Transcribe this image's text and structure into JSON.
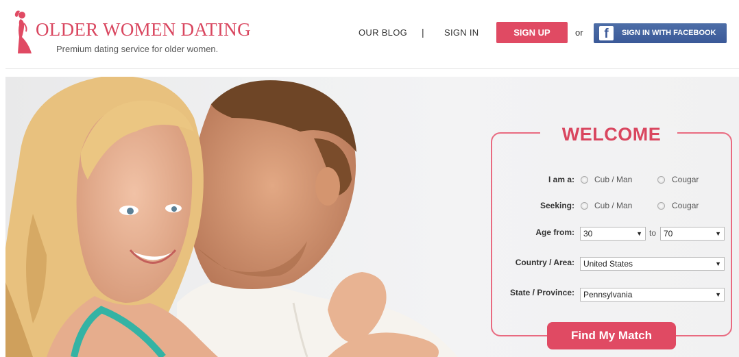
{
  "header": {
    "logo_title": "OLDER WOMEN DATING",
    "tagline": "Premium dating service for older women.",
    "nav": {
      "blog": "OUR BLOG",
      "separator": "|",
      "signin": "SIGN IN"
    },
    "signup": "SIGN UP",
    "or": "or",
    "facebook": {
      "icon_letter": "f",
      "label": "SIGN IN WITH FACEBOOK"
    }
  },
  "form": {
    "title": "WELCOME",
    "i_am_label": "I am a:",
    "i_am_options": [
      "Cub / Man",
      "Cougar"
    ],
    "seeking_label": "Seeking:",
    "seeking_options": [
      "Cub / Man",
      "Cougar"
    ],
    "age_label": "Age from:",
    "age_from": "30",
    "age_to_label": "to",
    "age_to": "70",
    "country_label": "Country / Area:",
    "country": "United States",
    "state_label": "State / Province:",
    "state": "Pennsylvania",
    "submit": "Find My Match"
  },
  "colors": {
    "brand_pink": "#e04a63",
    "title_pink": "#d9465f",
    "facebook_blue": "#3b5998"
  },
  "icons": {
    "logo": "woman-in-dress-icon",
    "facebook": "facebook-icon",
    "dropdown": "caret-down-icon"
  }
}
